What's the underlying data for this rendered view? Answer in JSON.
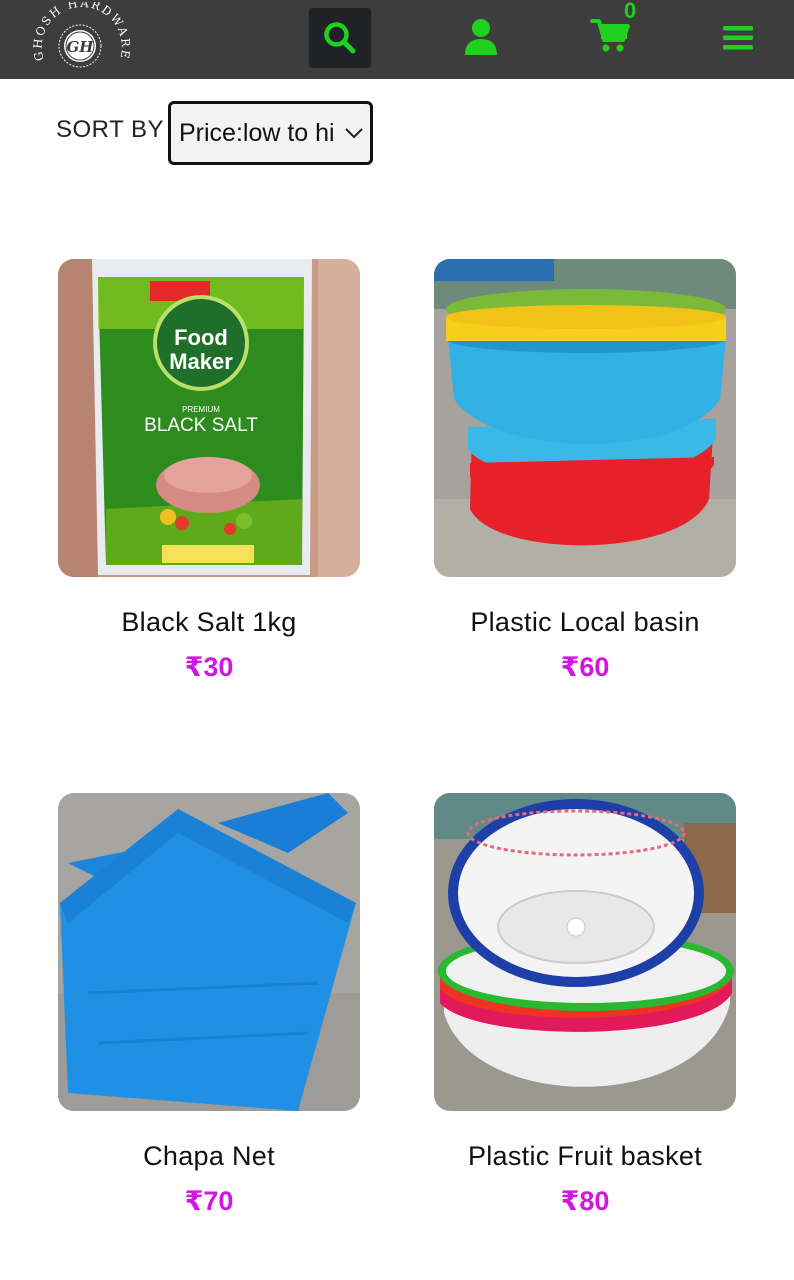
{
  "header": {
    "brand_name": "GHOSH HARDWARE",
    "brand_initials": "GH",
    "cart_count": "0",
    "accent_color": "#1ed11e",
    "background_color": "#3d3d3d",
    "icons": [
      "search-icon",
      "user-icon",
      "cart-icon",
      "hamburger-menu-icon"
    ]
  },
  "sort": {
    "label": "SORT BY",
    "selected": "Price:low to hi"
  },
  "products": [
    {
      "name": "Black Salt 1kg",
      "price": "₹30",
      "image": "black-salt-package"
    },
    {
      "name": "Plastic Local basin",
      "price": "₹60",
      "image": "plastic-basins-stack"
    },
    {
      "name": "Chapa Net",
      "price": "₹70",
      "image": "blue-net-fabric"
    },
    {
      "name": "Plastic Fruit basket",
      "price": "₹80",
      "image": "plastic-fruit-baskets"
    }
  ],
  "price_color": "#d016e0"
}
